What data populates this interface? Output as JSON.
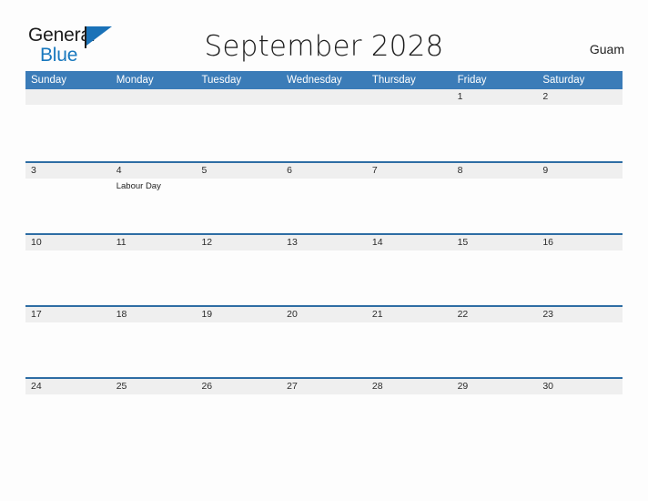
{
  "brand": {
    "name_part1": "General",
    "name_part2": "Blue",
    "flag_icon": "flag-icon",
    "accent_color": "#1878be"
  },
  "header": {
    "title": "September 2028",
    "locale": "Guam"
  },
  "theme": {
    "header_blue": "#3b7cb8",
    "divider_blue": "#2e6da4",
    "date_band_gray": "#efefef"
  },
  "calendar": {
    "weekdays": [
      "Sunday",
      "Monday",
      "Tuesday",
      "Wednesday",
      "Thursday",
      "Friday",
      "Saturday"
    ],
    "weeks": [
      {
        "days": [
          {
            "date": "",
            "events": []
          },
          {
            "date": "",
            "events": []
          },
          {
            "date": "",
            "events": []
          },
          {
            "date": "",
            "events": []
          },
          {
            "date": "",
            "events": []
          },
          {
            "date": "1",
            "events": []
          },
          {
            "date": "2",
            "events": []
          }
        ]
      },
      {
        "days": [
          {
            "date": "3",
            "events": []
          },
          {
            "date": "4",
            "events": [
              "Labour Day"
            ]
          },
          {
            "date": "5",
            "events": []
          },
          {
            "date": "6",
            "events": []
          },
          {
            "date": "7",
            "events": []
          },
          {
            "date": "8",
            "events": []
          },
          {
            "date": "9",
            "events": []
          }
        ]
      },
      {
        "days": [
          {
            "date": "10",
            "events": []
          },
          {
            "date": "11",
            "events": []
          },
          {
            "date": "12",
            "events": []
          },
          {
            "date": "13",
            "events": []
          },
          {
            "date": "14",
            "events": []
          },
          {
            "date": "15",
            "events": []
          },
          {
            "date": "16",
            "events": []
          }
        ]
      },
      {
        "days": [
          {
            "date": "17",
            "events": []
          },
          {
            "date": "18",
            "events": []
          },
          {
            "date": "19",
            "events": []
          },
          {
            "date": "20",
            "events": []
          },
          {
            "date": "21",
            "events": []
          },
          {
            "date": "22",
            "events": []
          },
          {
            "date": "23",
            "events": []
          }
        ]
      },
      {
        "days": [
          {
            "date": "24",
            "events": []
          },
          {
            "date": "25",
            "events": []
          },
          {
            "date": "26",
            "events": []
          },
          {
            "date": "27",
            "events": []
          },
          {
            "date": "28",
            "events": []
          },
          {
            "date": "29",
            "events": []
          },
          {
            "date": "30",
            "events": []
          }
        ]
      }
    ]
  }
}
